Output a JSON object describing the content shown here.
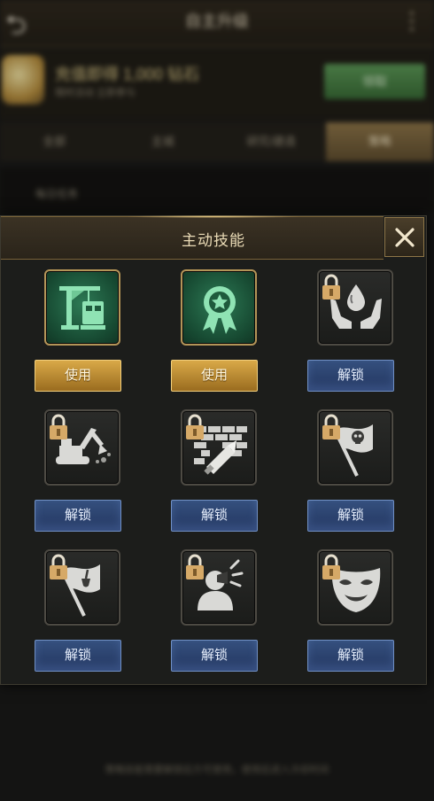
{
  "background": {
    "title": "自主升级",
    "banner_text": "充值即得 1,000 钻石",
    "banner_sub": "限时活动 立即参与",
    "banner_button": "领取",
    "tabs": [
      "全部",
      "主城",
      "研究/建造",
      "策略"
    ],
    "active_tab": 3,
    "row_text": "每日任务",
    "footer_text": "策略技能需要解锁后方可使用，使用后进入冷却时间"
  },
  "modal": {
    "title": "主动技能",
    "close_icon": "close-icon"
  },
  "skills": [
    {
      "icon": "construction-crane-icon",
      "button": "使用",
      "state": "active"
    },
    {
      "icon": "medal-ribbon-icon",
      "button": "使用",
      "state": "active"
    },
    {
      "icon": "hands-water-drop-icon",
      "button": "解锁",
      "state": "locked"
    },
    {
      "icon": "excavator-icon",
      "button": "解锁",
      "state": "locked"
    },
    {
      "icon": "brick-wall-bullet-icon",
      "button": "解锁",
      "state": "locked"
    },
    {
      "icon": "skull-flag-icon",
      "button": "解锁",
      "state": "locked"
    },
    {
      "icon": "shovel-flag-icon",
      "button": "解锁",
      "state": "locked"
    },
    {
      "icon": "shouting-person-icon",
      "button": "解锁",
      "state": "locked"
    },
    {
      "icon": "theater-mask-icon",
      "button": "解锁",
      "state": "locked"
    }
  ],
  "colors": {
    "use_button": "#c89432",
    "unlock_button": "#2c4470",
    "active_icon_bg": "#1f5c3e",
    "header_gold": "#7a6338"
  }
}
